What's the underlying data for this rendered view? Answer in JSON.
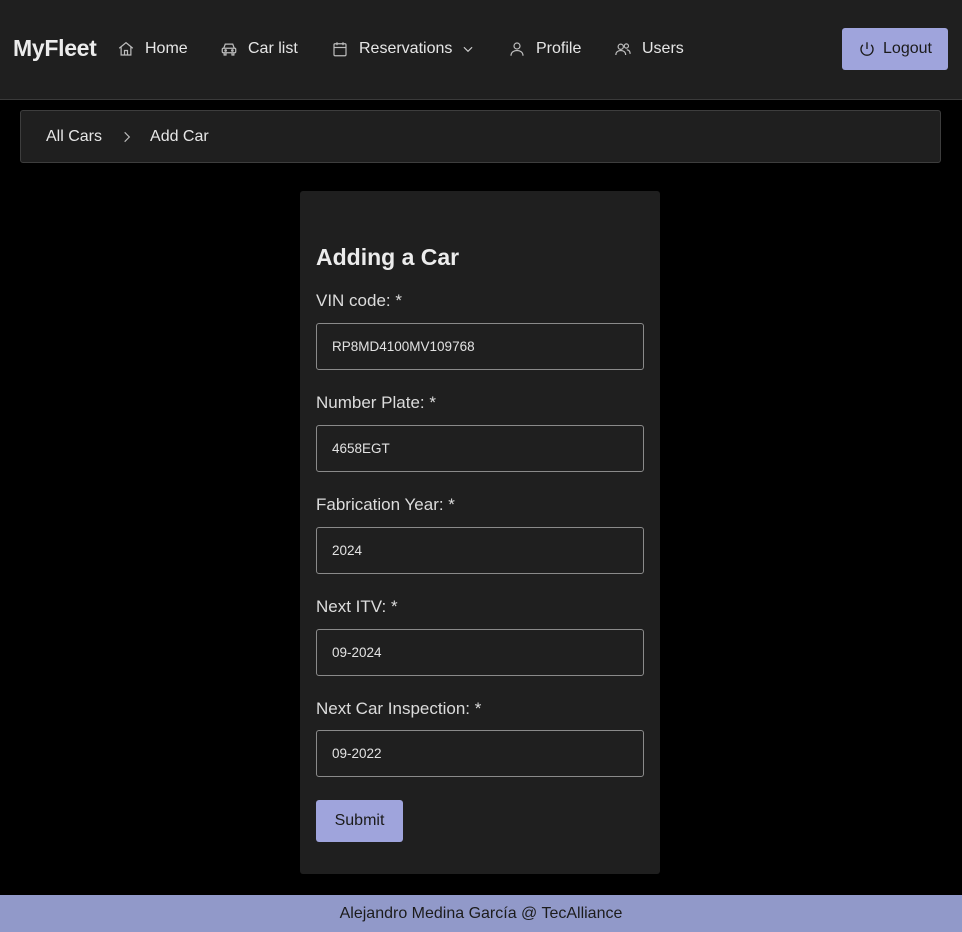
{
  "navbar": {
    "brand": "MyFleet",
    "items": [
      {
        "label": "Home",
        "icon": "home-icon"
      },
      {
        "label": "Car list",
        "icon": "car-icon"
      },
      {
        "label": "Reservations",
        "icon": "calendar-icon"
      },
      {
        "label": "Profile",
        "icon": "user-icon"
      },
      {
        "label": "Users",
        "icon": "users-icon"
      }
    ],
    "logout_label": "Logout"
  },
  "breadcrumb": {
    "items": [
      "All Cars",
      "Add Car"
    ]
  },
  "form": {
    "title": "Adding a Car",
    "fields": [
      {
        "label": "VIN code: *",
        "value": "RP8MD4100MV109768"
      },
      {
        "label": "Number Plate: *",
        "value": "4658EGT"
      },
      {
        "label": "Fabrication Year: *",
        "value": "2024"
      },
      {
        "label": "Next ITV: *",
        "value": "09-2024"
      },
      {
        "label": "Next Car Inspection: *",
        "value": "09-2022"
      }
    ],
    "submit_label": "Submit"
  },
  "footer": {
    "text": "Alejandro Medina García @ TecAlliance"
  },
  "colors": {
    "accent": "#9fa4dc",
    "footer": "#9199c9",
    "surface": "#1f1f1f",
    "background": "#000000"
  }
}
